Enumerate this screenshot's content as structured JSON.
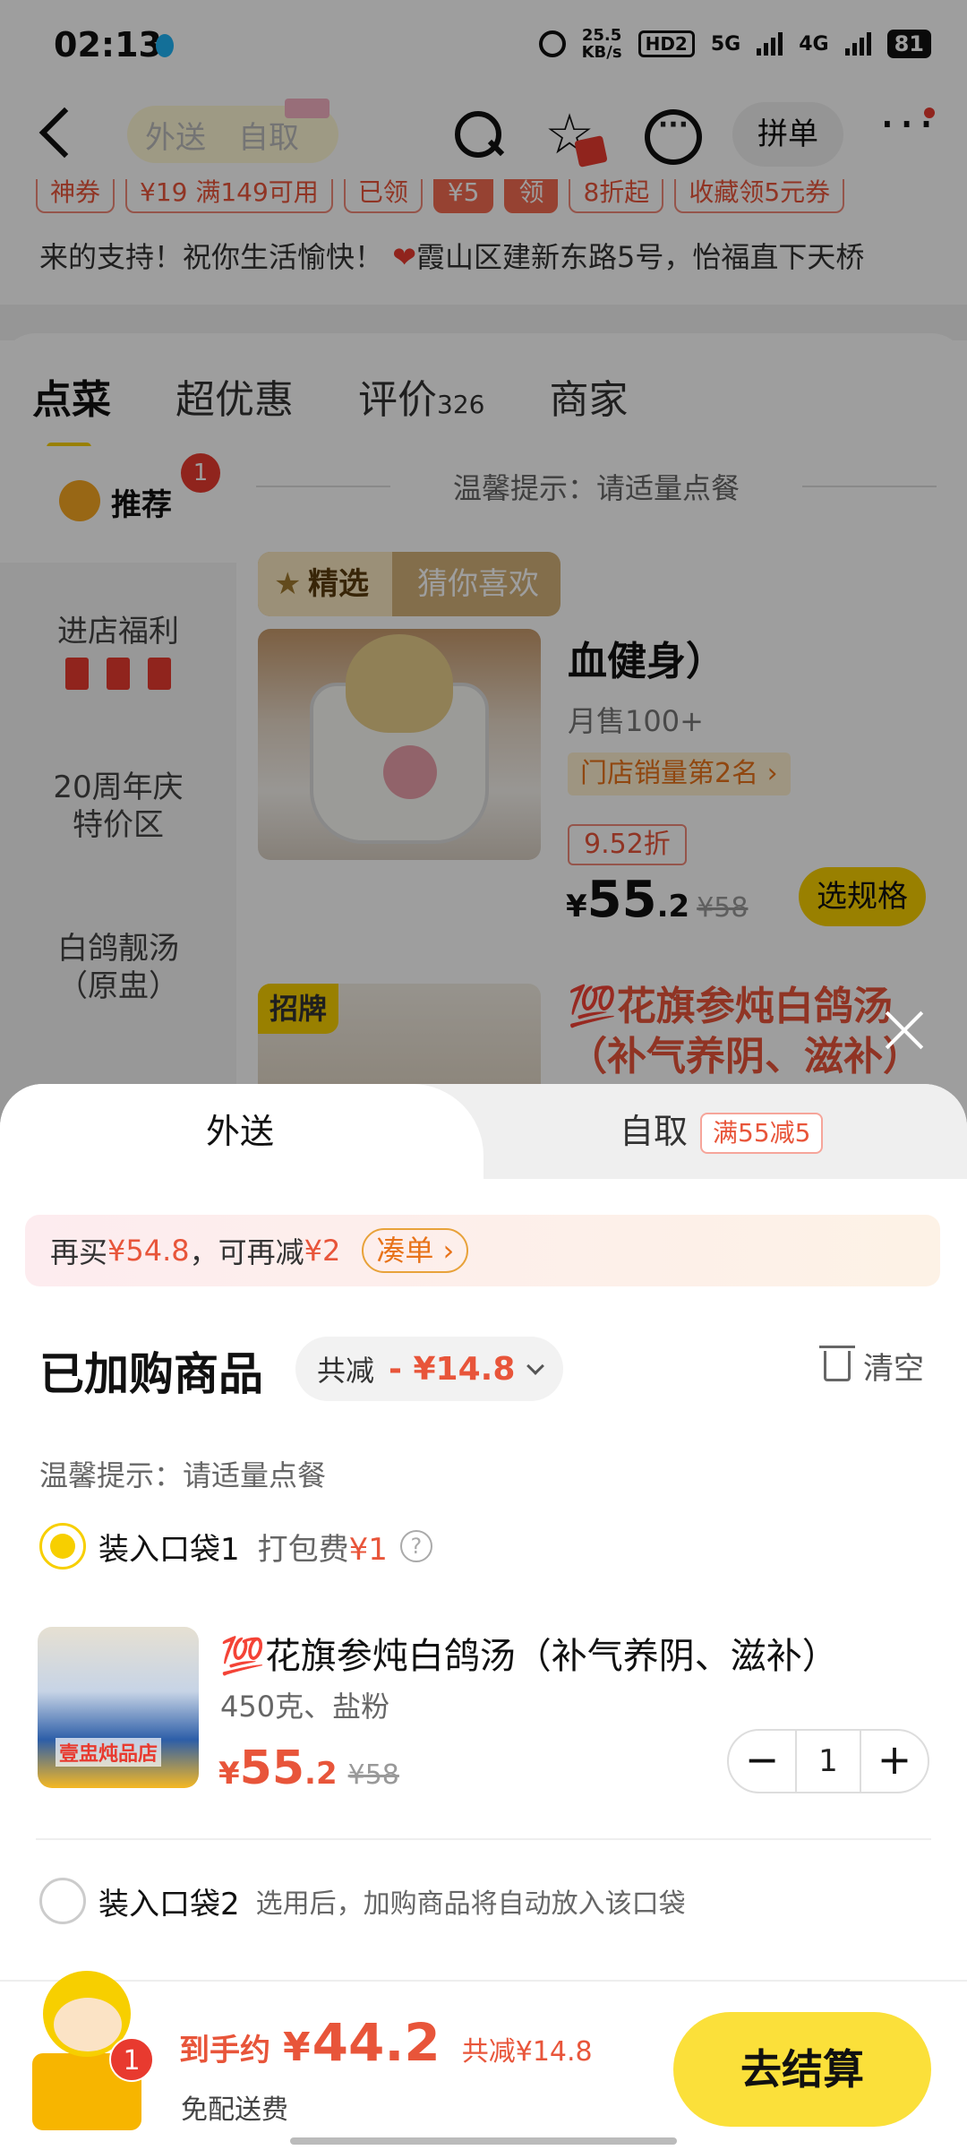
{
  "status_bar": {
    "time": "02:13",
    "net_speed_value": "25.5",
    "net_speed_unit": "KB/s",
    "hd": "HD2",
    "sim1": "5G",
    "sim2": "4G",
    "battery": "81"
  },
  "nav": {
    "mode_delivery": "外送",
    "mode_pickup": "自取",
    "pin_label": "拼单"
  },
  "coupons": [
    "神券",
    "¥19 满149可用",
    "已领",
    "¥5",
    "领",
    "8折起",
    "收藏领5元券"
  ],
  "notice": {
    "text": "来的支持！祝你生活愉快！",
    "address": "霞山区建新东路5号，怡福直下天桥"
  },
  "tabs": [
    {
      "label": "点菜"
    },
    {
      "label": "超优惠"
    },
    {
      "label": "评价",
      "count": "326"
    },
    {
      "label": "商家"
    }
  ],
  "side_menu": {
    "recommend_label": "推荐",
    "recommend_badge": "1",
    "items": [
      "进店福利",
      "20周年庆\n特价区",
      "白鸽靓汤\n（原盅）"
    ]
  },
  "menu": {
    "tip": "温馨提示：请适量点餐",
    "picked_tag_left": "精选",
    "picked_tag_right": "猜你喜欢",
    "dish1": {
      "title": "血健身）",
      "sales": "月售100+",
      "rank": "门店销量第2名 ›",
      "discount": "9.52折",
      "price_int": "55",
      "price_dec": ".2",
      "original_price": "¥58",
      "spec_button": "选规格"
    },
    "dish2": {
      "tag": "招牌",
      "title": "💯花旗参炖白鸽汤（补气养阴、滋补）"
    }
  },
  "sheet": {
    "tab_delivery": "外送",
    "tab_pickup": "自取",
    "pickup_promo": "满55减5",
    "addmore": {
      "prefix": "再买",
      "amount": "¥54.8",
      "middle": "，可再减",
      "saving": "¥2",
      "button": "凑单 ›"
    },
    "cart_title": "已加购商品",
    "total_discount_label": "共减",
    "total_discount_amount": "- ¥14.8",
    "clear_label": "清空",
    "tip": "温馨提示：请适量点餐",
    "bag1": {
      "label": "装入口袋1",
      "pack_fee_label": "打包费",
      "pack_fee_amount": "¥1"
    },
    "item": {
      "shop_label": "壹盅炖品店",
      "title_emoji": "💯",
      "title": "花旗参炖白鸽汤（补气养阴、滋补）",
      "spec": "450克、盐粉",
      "price_int": "55",
      "price_dec": ".2",
      "original_price": "¥58",
      "quantity": "1"
    },
    "bag2": {
      "label": "装入口袋2",
      "hint": "选用后，加购商品将自动放入该口袋"
    }
  },
  "checkout": {
    "cart_badge": "1",
    "label": "到手约",
    "amount": "44.2",
    "total_saving": "共减¥14.8",
    "free_shipping": "免配送费",
    "button": "去结算"
  },
  "colors": {
    "brand_yellow": "#f7cf00",
    "price_red": "#e8553a"
  }
}
